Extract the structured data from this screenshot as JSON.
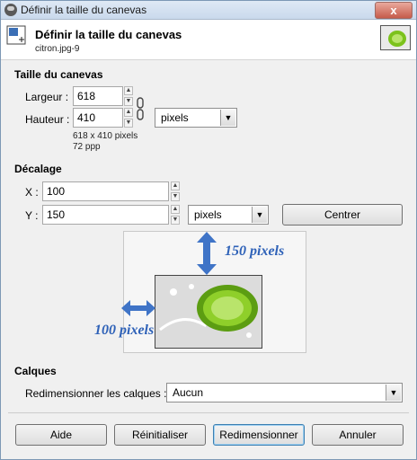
{
  "window": {
    "title": "Définir la taille du canevas",
    "close": "x"
  },
  "header": {
    "title": "Définir la taille du canevas",
    "subtitle": "citron.jpg-9"
  },
  "canvas_size": {
    "section": "Taille du canevas",
    "width_label": "Largeur :",
    "width_value": "618",
    "height_label": "Hauteur :",
    "height_value": "410",
    "unit": "pixels",
    "info_pixels": "618 x 410 pixels",
    "info_ppp": "72 ppp"
  },
  "offset": {
    "section": "Décalage",
    "x_label": "X :",
    "x_value": "100",
    "y_label": "Y :",
    "y_value": "150",
    "unit": "pixels",
    "center_button": "Centrer"
  },
  "annotations": {
    "vertical": "150 pixels",
    "horizontal": "100 pixels"
  },
  "layers": {
    "section": "Calques",
    "resize_label": "Redimensionner les calques :",
    "resize_value": "Aucun"
  },
  "buttons": {
    "help": "Aide",
    "reset": "Réinitialiser",
    "resize": "Redimensionner",
    "cancel": "Annuler"
  },
  "colors": {
    "accent": "#3c7fb1",
    "annotation": "#2f62b8",
    "lime": "#7cc21c"
  }
}
